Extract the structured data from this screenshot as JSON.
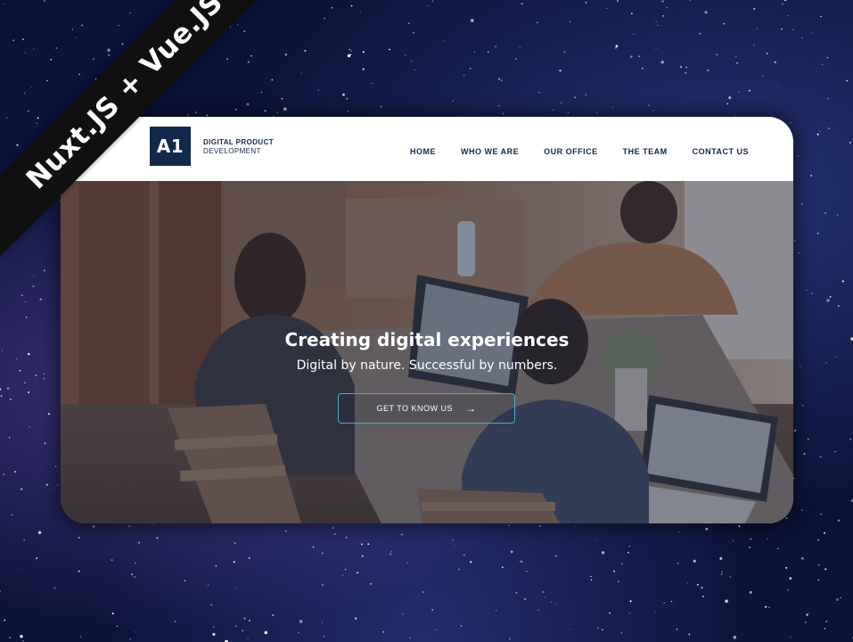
{
  "banner": {
    "ribbon_text": "Nuxt.JS + Vue.JS"
  },
  "site": {
    "logo_mark": "A1",
    "logo_line1": "DIGITAL PRODUCT",
    "logo_line2": "DEVELOPMENT",
    "brand_color": "#13294b",
    "nav": [
      {
        "label": "HOME"
      },
      {
        "label": "WHO WE ARE"
      },
      {
        "label": "OUR OFFICE"
      },
      {
        "label": "THE TEAM"
      },
      {
        "label": "CONTACT US"
      }
    ]
  },
  "hero": {
    "title": "Creating digital experiences",
    "subtitle": "Digital by nature. Successful by numbers.",
    "cta_label": "GET TO KNOW US",
    "cta_icon": "arrow-right-icon",
    "cta_border_color": "#4fa9d8"
  }
}
